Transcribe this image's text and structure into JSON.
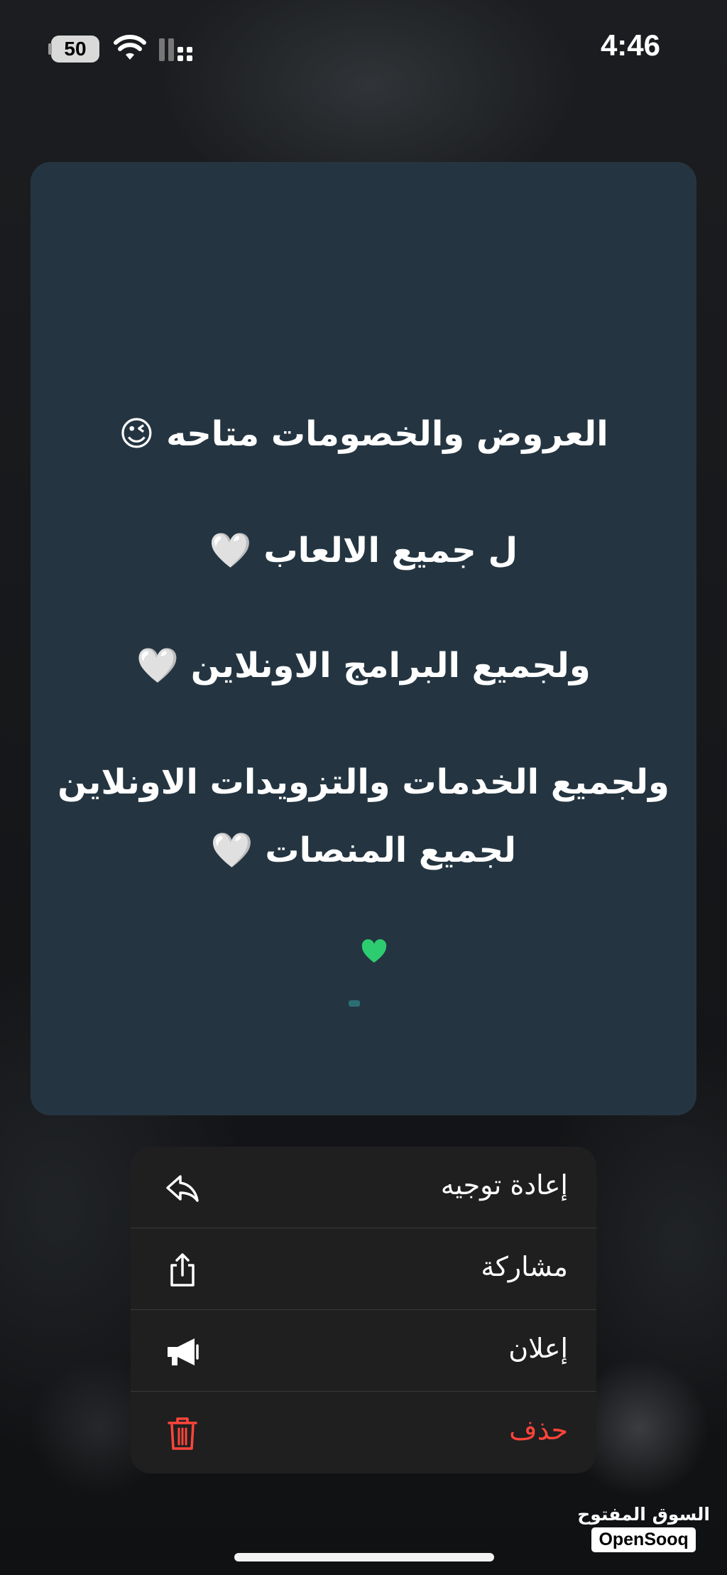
{
  "status_bar": {
    "time": "4:46",
    "battery": "50"
  },
  "message": {
    "lines": [
      "العروض والخصومات متاحه 😉",
      "ل جميع الالعاب 🤍",
      "ولجميع البرامج الاونلاين 🤍",
      "ولجميع الخدمات والتزويدات الاونلاين",
      "لجميع المنصات 🤍"
    ],
    "accent_heart_color": "#2ecc71"
  },
  "menu": {
    "items": [
      {
        "label": "إعادة توجيه",
        "icon": "forward-arrow-icon"
      },
      {
        "label": "مشاركة",
        "icon": "share-icon"
      },
      {
        "label": "إعلان",
        "icon": "megaphone-icon"
      },
      {
        "label": "حذف",
        "icon": "trash-icon",
        "color": "#ff453a"
      }
    ]
  },
  "watermark": {
    "arabic": "السوق المفتوح",
    "english": "OpenSooq"
  }
}
